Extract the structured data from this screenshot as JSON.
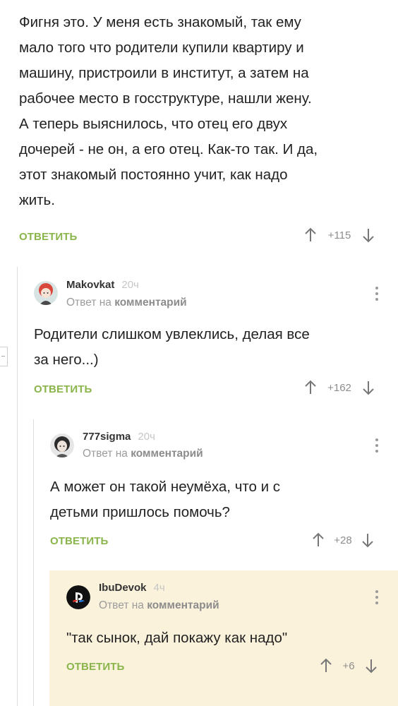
{
  "top_comment": {
    "text_lines": [
      "Фигня это. У меня есть знакомый, так ему",
      "мало того что родители купили квартиру и",
      "машину, пристроили в институт, а затем на",
      "рабочее место в госструктуре, нашли жену.",
      "А теперь выяснилось, что отец его двух",
      "дочерей - не он, а его отец. Как-то так. И да,",
      "этот знакомый постоянно учит, как надо",
      "жить."
    ],
    "reply_label": "ОТВЕТИТЬ",
    "rating": "+115"
  },
  "comments": [
    {
      "username": "Makovkat",
      "time": "20ч",
      "meta_prefix": "Ответ на",
      "meta_link": "комментарий",
      "text_lines": [
        "Родители слишком увлеклись, делая все",
        "за него...)"
      ],
      "reply_label": "ОТВЕТИТЬ",
      "rating": "+162"
    },
    {
      "username": "777sigma",
      "time": "20ч",
      "meta_prefix": "Ответ на",
      "meta_link": "комментарий",
      "text_lines": [
        "А может он такой неумёха, что и с",
        "детьми пришлось помочь?"
      ],
      "reply_label": "ОТВЕТИТЬ",
      "rating": "+28"
    },
    {
      "username": "IbuDevok",
      "time": "4ч",
      "meta_prefix": "Ответ на",
      "meta_link": "комментарий",
      "text_lines": [
        "\"так сынок, дай покажу как надо\""
      ],
      "reply_label": "ОТВЕТИТЬ",
      "rating": "+6"
    }
  ],
  "colors": {
    "accent": "#8ab54b",
    "highlight_bg": "#fbf2dc",
    "thread_line": "#dcdcdc"
  },
  "icons": [
    "arrow-up-icon",
    "arrow-down-icon",
    "more-vertical-icon",
    "collapse-icon"
  ]
}
